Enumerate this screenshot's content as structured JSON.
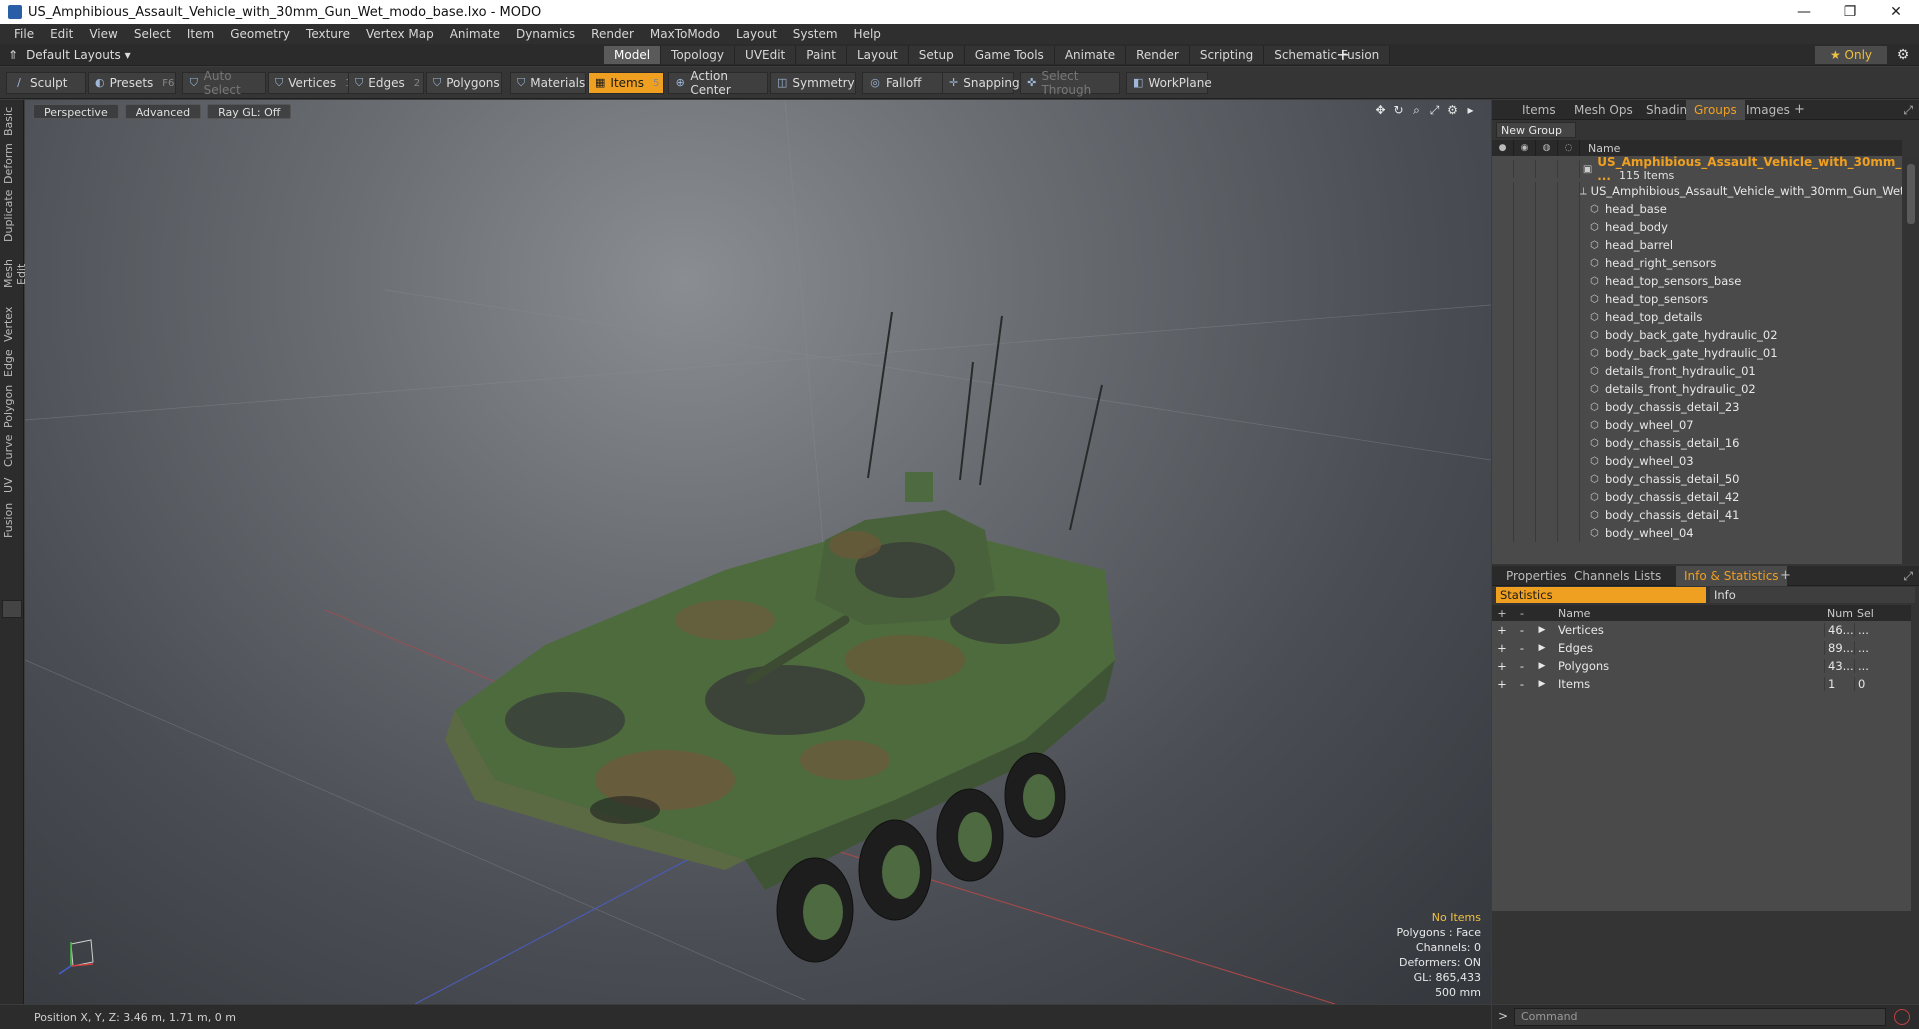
{
  "window": {
    "title": "US_Amphibious_Assault_Vehicle_with_30mm_Gun_Wet_modo_base.lxo - MODO",
    "controls": [
      "—",
      "❐",
      "✕"
    ]
  },
  "menu": [
    "File",
    "Edit",
    "View",
    "Select",
    "Item",
    "Geometry",
    "Texture",
    "Vertex Map",
    "Animate",
    "Dynamics",
    "Render",
    "MaxToModo",
    "Layout",
    "System",
    "Help"
  ],
  "layoutbar": {
    "layout_label": "Default Layouts ▾",
    "tabs": [
      "Model",
      "Topology",
      "UVEdit",
      "Paint",
      "Layout",
      "Setup",
      "Game Tools",
      "Animate",
      "Render",
      "Scripting",
      "Schematic Fusion"
    ],
    "active_tab": "Model",
    "only_label": "★  Only"
  },
  "toolbar": {
    "sculpt": "Sculpt",
    "presets": "Presets",
    "presets_key": "F6",
    "auto_select": "Auto Select",
    "vertices": "Vertices",
    "vertices_key": "1",
    "edges": "Edges",
    "edges_key": "2",
    "polygons": "Polygons",
    "materials": "Materials",
    "items": "Items",
    "items_key": "5",
    "action_center": "Action Center",
    "symmetry": "Symmetry",
    "falloff": "Falloff",
    "snapping": "Snapping",
    "select_through": "Select Through",
    "workplane": "WorkPlane"
  },
  "left_tabs": [
    "Basic",
    "Deform",
    "Duplicate",
    "Mesh Edit",
    "Vertex",
    "Edge",
    "Polygon",
    "Curve",
    "UV",
    "Fusion"
  ],
  "viewport": {
    "view_mode": "Perspective",
    "shading": "Advanced",
    "raygl": "Ray GL: Off",
    "info": {
      "selection": "No Items",
      "polygons": "Polygons : Face",
      "channels": "Channels: 0",
      "deformers": "Deformers: ON",
      "gl": "GL: 865,433",
      "scale": "500 mm"
    }
  },
  "groups_panel": {
    "tabs": [
      "Items",
      "Mesh Ops",
      "Shading",
      "Groups",
      "Images"
    ],
    "active_tab": "Groups",
    "new_group": "New Group",
    "column_name": "Name",
    "group_name": "US_Amphibious_Assault_Vehicle_with_30mm_ ...",
    "group_count": "115 Items",
    "items": [
      "US_Amphibious_Assault_Vehicle_with_30mm_Gun_Wet",
      "head_base",
      "head_body",
      "head_barrel",
      "head_right_sensors",
      "head_top_sensors_base",
      "head_top_sensors",
      "head_top_details",
      "body_back_gate_hydraulic_02",
      "body_back_gate_hydraulic_01",
      "details_front_hydraulic_01",
      "details_front_hydraulic_02",
      "body_chassis_detail_23",
      "body_wheel_07",
      "body_chassis_detail_16",
      "body_wheel_03",
      "body_chassis_detail_50",
      "body_chassis_detail_42",
      "body_chassis_detail_41",
      "body_wheel_04"
    ]
  },
  "stats_panel": {
    "tabs": [
      "Properties",
      "Channels",
      "Lists",
      "Info & Statistics"
    ],
    "active_tab": "Info & Statistics",
    "subtabs": [
      "Statistics",
      "Info"
    ],
    "columns": {
      "name": "Name",
      "num": "Num",
      "sel": "Sel"
    },
    "rows": [
      {
        "name": "Vertices",
        "num": "46...",
        "sel": "..."
      },
      {
        "name": "Edges",
        "num": "89...",
        "sel": "..."
      },
      {
        "name": "Polygons",
        "num": "43...",
        "sel": "..."
      },
      {
        "name": "Items",
        "num": "1",
        "sel": "0"
      }
    ]
  },
  "statusbar": {
    "position": "Position X, Y, Z:  3.46 m, 1.71 m, 0 m"
  },
  "command": {
    "prompt": ">",
    "placeholder": "Command"
  },
  "colors": {
    "accent": "#f0a020",
    "highlight_text": "#f0c040"
  }
}
